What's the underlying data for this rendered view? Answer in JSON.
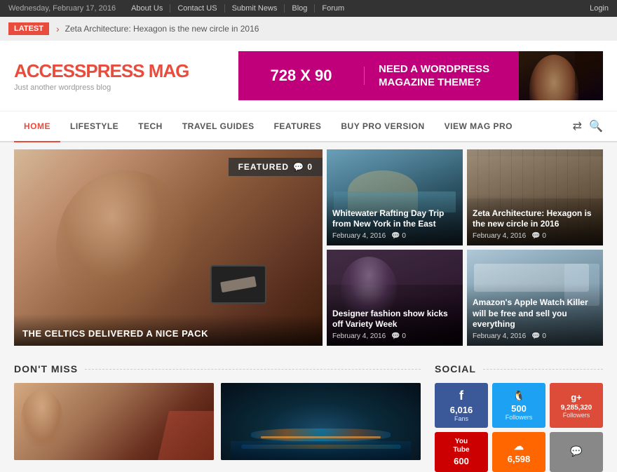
{
  "topbar": {
    "date": "Wednesday, February 17, 2016",
    "nav_items": [
      "About Us",
      "Contact US",
      "Submit News",
      "Blog",
      "Forum"
    ],
    "login_label": "Login"
  },
  "breaking": {
    "label": "LATEST",
    "arrow": "›",
    "text": "Zeta Architecture: Hexagon is the new circle in 2016"
  },
  "header": {
    "logo_main": "ACCESSPRESS",
    "logo_accent": " MAG",
    "logo_sub": "Just another wordpress blog",
    "banner_size": "728 X 90",
    "banner_text": "NEED A WORDPRESS MAGAZINE THEME?"
  },
  "nav": {
    "items": [
      {
        "label": "HOME",
        "active": true
      },
      {
        "label": "LIFESTYLE",
        "active": false
      },
      {
        "label": "TECH",
        "active": false
      },
      {
        "label": "TRAVEL GUIDES",
        "active": false
      },
      {
        "label": "FEATURES",
        "active": false
      },
      {
        "label": "BUY PRO VERSION",
        "active": false
      },
      {
        "label": "VIEW MAG PRO",
        "active": false
      }
    ],
    "shuffle_icon": "⇄",
    "search_icon": "🔍"
  },
  "featured": {
    "badge": "FEATURED",
    "badge_count": "🗨 0",
    "caption": "THE CELTICS DELIVERED A NICE PACK"
  },
  "grid_cards": [
    {
      "title": "Whitewater Rafting Day Trip from New York in the East",
      "date": "February 4, 2016",
      "comments": "🗨 0",
      "bg_class": "card-rafting"
    },
    {
      "title": "Zeta Architecture: Hexagon is the new circle in 2016",
      "date": "February 4, 2016",
      "comments": "🗨 0",
      "bg_class": "card-architecture"
    },
    {
      "title": "Designer fashion show kicks off Variety Week",
      "date": "February 4, 2016",
      "comments": "🗨 0",
      "bg_class": "card-fashion"
    },
    {
      "title": "Amazon's Apple Watch Killer will be free and sell you everything",
      "date": "February 4, 2016",
      "comments": "🗨 0",
      "bg_class": "card-amazon"
    }
  ],
  "dont_miss": {
    "title": "DON'T MISS"
  },
  "social": {
    "title": "SOCIAL",
    "buttons": [
      {
        "icon": "f",
        "count": "6,016",
        "label": "Fans",
        "class": "social-fb"
      },
      {
        "icon": "t",
        "count": "500",
        "label": "Followers",
        "class": "social-tw"
      },
      {
        "icon": "g+",
        "count": "9,285,320",
        "label": "Followers",
        "class": "social-gp"
      },
      {
        "icon": "You\nTube",
        "count": "600",
        "label": "",
        "class": "social-yt"
      },
      {
        "icon": "☁",
        "count": "6,598",
        "label": "",
        "class": "social-cloud"
      },
      {
        "icon": "🗨",
        "count": "",
        "label": "",
        "class": "social-chat"
      }
    ]
  }
}
